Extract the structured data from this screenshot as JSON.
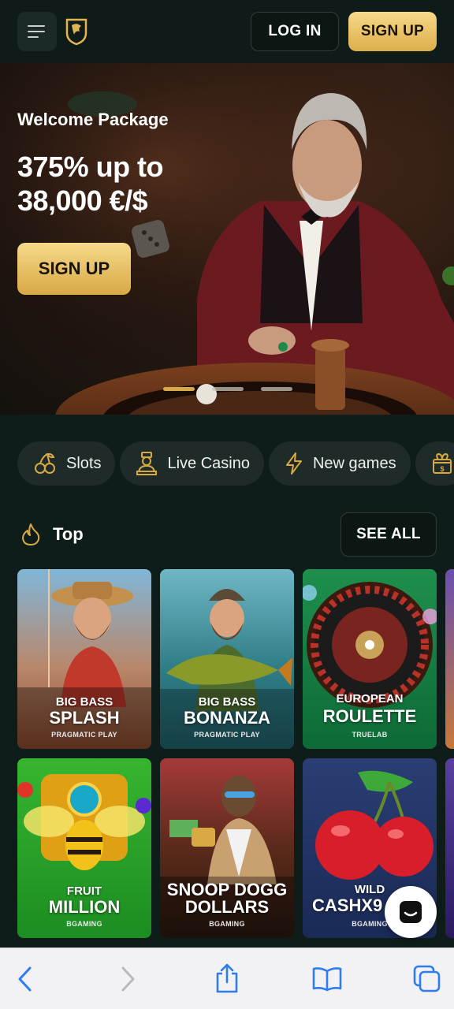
{
  "header": {
    "login_label": "LOG IN",
    "signup_label": "SIGN UP"
  },
  "hero": {
    "title": "Welcome Package",
    "offer": "375% up to 38,000 €/$",
    "signup_label": "SIGN UP",
    "slides_total": 3,
    "active_slide": 1
  },
  "categories": [
    {
      "label": "Slots",
      "icon": "cherries-icon"
    },
    {
      "label": "Live Casino",
      "icon": "dealer-icon"
    },
    {
      "label": "New games",
      "icon": "lightning-icon"
    },
    {
      "label": "",
      "icon": "gift-icon"
    }
  ],
  "top_section": {
    "title": "Top",
    "see_all_label": "SEE ALL"
  },
  "games": [
    {
      "line1": "BIG BASS",
      "line2": "SPLASH",
      "provider": "PRAGMATIC PLAY"
    },
    {
      "line1": "BIG BASS",
      "line2": "BONANZA",
      "provider": "PRAGMATIC PLAY"
    },
    {
      "line1": "EUROPEAN",
      "line2": "ROULETTE",
      "provider": "TRUELAB"
    },
    {
      "line1": "FRUIT",
      "line2": "MILLION",
      "provider": "BGAMING"
    },
    {
      "line1": "SNOOP DOGG",
      "line2": "DOLLARS",
      "provider": "BGAMING"
    },
    {
      "line1": "WILD",
      "line2": "CASHX9",
      "provider": "BGAMING"
    }
  ],
  "colors": {
    "accent_gold": "#e2b552",
    "background": "#0f1d1a",
    "chip": "#1e2b28"
  }
}
